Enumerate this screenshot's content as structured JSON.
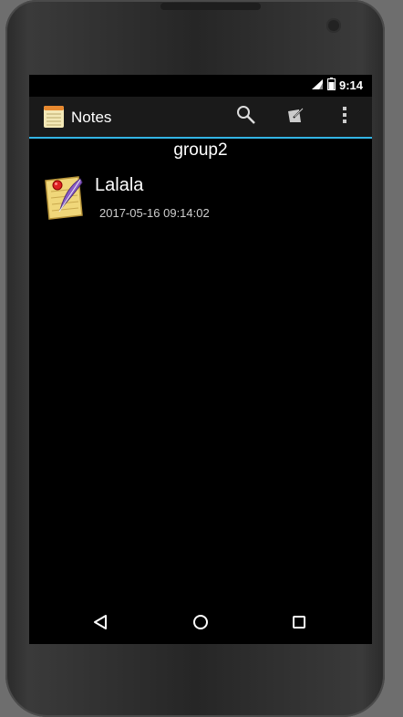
{
  "status_bar": {
    "time": "9:14",
    "icons": [
      "signal-icon",
      "battery-icon"
    ]
  },
  "action_bar": {
    "title": "Notes",
    "app_icon": "notepad-icon",
    "actions": [
      {
        "name": "search-icon"
      },
      {
        "name": "new-note-icon"
      },
      {
        "name": "overflow-menu-icon"
      }
    ],
    "accent_color": "#33b5e5"
  },
  "group": {
    "name": "group2"
  },
  "notes": [
    {
      "title": "Lalala",
      "date": "2017-05-16 09:14:02",
      "icon": "note-quill-icon"
    }
  ],
  "nav_bar": {
    "buttons": [
      "back-icon",
      "home-icon",
      "recents-icon"
    ]
  }
}
